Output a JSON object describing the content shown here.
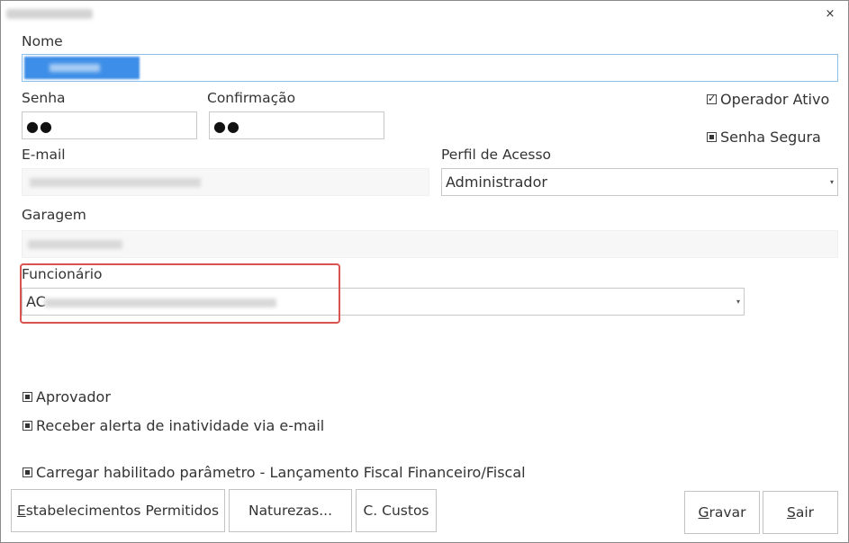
{
  "window": {
    "close_glyph": "×"
  },
  "fields": {
    "nome_label": "Nome",
    "senha_label": "Senha",
    "senha_value": "●●",
    "confirmacao_label": "Confirmação",
    "confirmacao_value": "●●",
    "email_label": "E-mail",
    "perfil_label": "Perfil de Acesso",
    "perfil_value": "Administrador",
    "garagem_label": "Garagem",
    "funcionario_label": "Funcionário",
    "funcionario_value_visible": "AC"
  },
  "checkboxes": {
    "operador_ativo": {
      "label": "Operador Ativo",
      "checked": true
    },
    "senha_segura": {
      "label": "Senha Segura",
      "checked": false
    },
    "aprovador": {
      "label": "Aprovador",
      "checked": false
    },
    "receber_alerta": {
      "label": "Receber alerta de inatividade via e-mail",
      "checked": false
    },
    "carregar_habilitado": {
      "label": "Carregar habilitado parâmetro - Lançamento Fiscal Financeiro/Fiscal",
      "checked": false
    }
  },
  "buttons": {
    "estabelecimentos_first": "E",
    "estabelecimentos_rest": "stabelecimentos Permitidos",
    "naturezas": "Naturezas...",
    "custos": "C. Custos",
    "gravar_first": "G",
    "gravar_rest": "ravar",
    "sair_first": "S",
    "sair_rest": "air"
  },
  "icons": {
    "dropdown": "▾"
  },
  "colors": {
    "highlight_border": "#d9534f",
    "selection": "#3d8ee8",
    "focus_border": "#8cc0ec"
  }
}
